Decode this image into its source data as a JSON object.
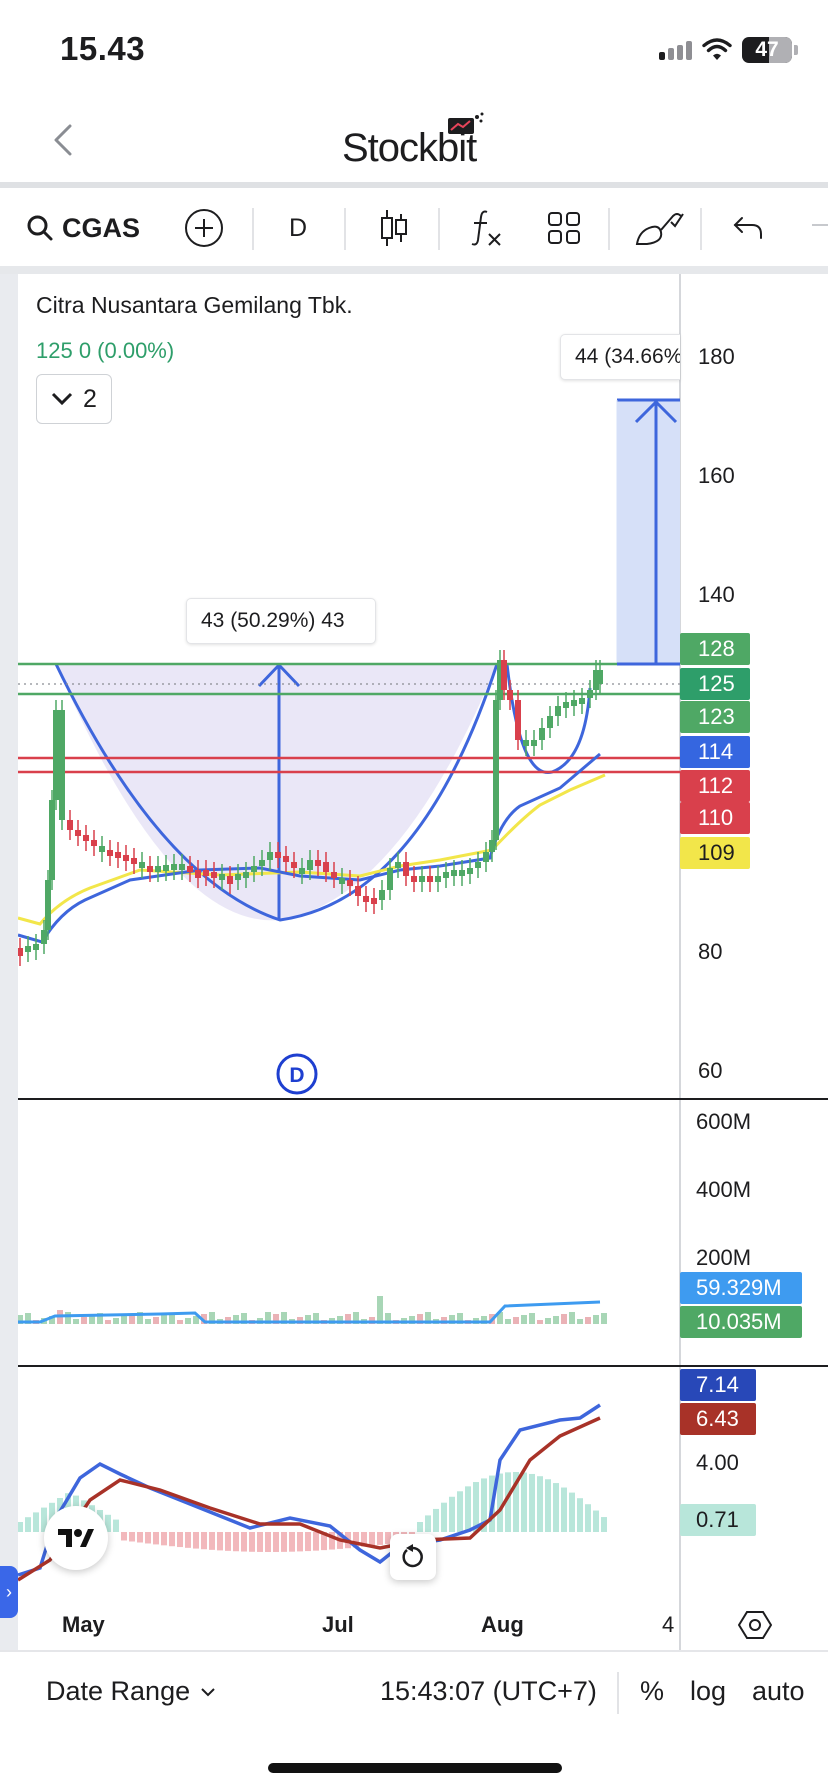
{
  "status_bar": {
    "time": "15.43",
    "battery": "47"
  },
  "header": {
    "brand": "Stockbit"
  },
  "toolbar": {
    "symbol": "CGAS",
    "interval": "D"
  },
  "legend": {
    "company": "Citra Nusantara Gemilang Tbk.",
    "price_change": "125  0 (0.00%)",
    "collapse_count": "2"
  },
  "measurements": {
    "main": "43 (50.29%) 43",
    "target": "44 (34.66%"
  },
  "price_axis": {
    "labels": [
      "180",
      "160",
      "140",
      "80",
      "60"
    ]
  },
  "price_tags": [
    {
      "value": "128",
      "color": "#4fa865"
    },
    {
      "value": "125",
      "color": "#2e9e6a"
    },
    {
      "value": "123",
      "color": "#4fa865"
    },
    {
      "value": "114",
      "color": "#3566e0"
    },
    {
      "value": "112",
      "color": "#d9404c"
    },
    {
      "value": "110",
      "color": "#d9404c"
    },
    {
      "value": "109",
      "color": "#f2e64a"
    }
  ],
  "event_badge": "D",
  "volume_axis": {
    "labels": [
      "600M",
      "400M",
      "200M"
    ]
  },
  "volume_tags": [
    {
      "value": "59.329M",
      "color": "#3e9bf0"
    },
    {
      "value": "10.035M",
      "color": "#4fa865"
    }
  ],
  "oscillator_axis": {
    "labels": [
      "4.00"
    ]
  },
  "oscillator_tags": [
    {
      "value": "7.14",
      "color": "#2848b8"
    },
    {
      "value": "6.43",
      "color": "#a83228"
    },
    {
      "value": "0.71",
      "color": "#b8e6da"
    }
  ],
  "time_axis": {
    "labels": [
      "May",
      "Jul",
      "Aug",
      "4"
    ]
  },
  "bottom_bar": {
    "date_range": "Date Range",
    "clock": "15:43:07 (UTC+7)",
    "percent": "%",
    "log": "log",
    "auto": "auto"
  },
  "colors": {
    "up": "#4fa865",
    "down": "#d9404c",
    "ma_blue": "#3e66dc",
    "ma_yellow": "#f2e64a",
    "drawing": "#3e66dc",
    "cup_fill": "#e6e3f6",
    "target_fill": "#d6e0f8"
  }
}
